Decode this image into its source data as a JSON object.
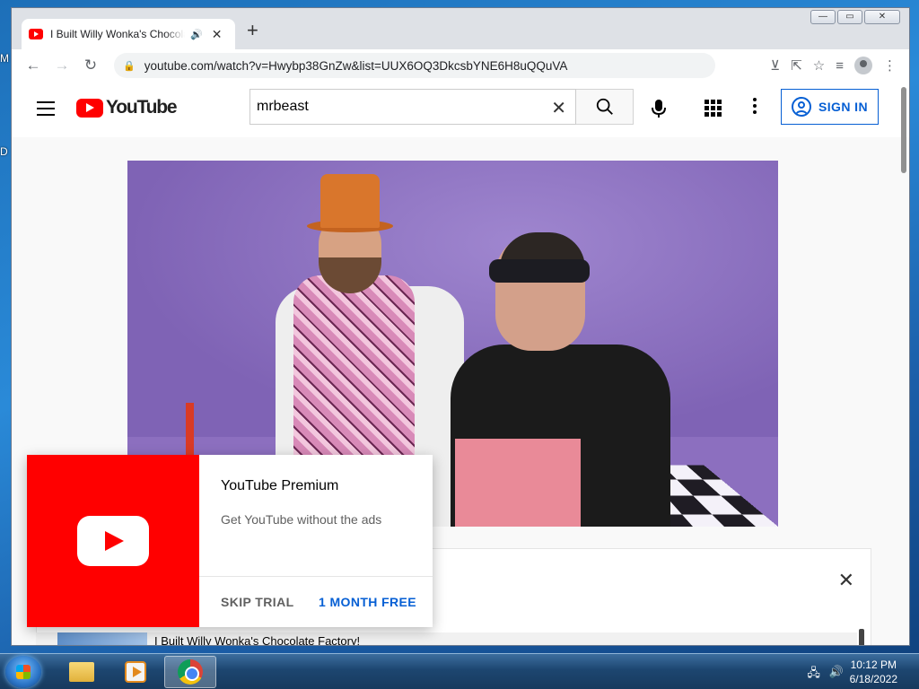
{
  "desktop": {
    "edge_labels": [
      "M",
      "D"
    ]
  },
  "browser": {
    "tab_title": "I Built Willy Wonka's Chocolate Factory!",
    "url": "youtube.com/watch?v=Hwybp38GnZw&list=UUX6OQ3DkcsbYNE6H8uQQuVA",
    "window_controls": {
      "minimize": "—",
      "maximize": "▭",
      "close": "✕"
    }
  },
  "youtube": {
    "logo_text": "YouTube",
    "search": {
      "value": "mrbeast"
    },
    "sign_in_label": "SIGN IN"
  },
  "promo": {
    "title": "YouTube Premium",
    "subtitle": "Get YouTube without the ads",
    "skip_label": "SKIP TRIAL",
    "free_label": "1 MONTH FREE"
  },
  "below_video": {
    "mini_title": "I Built Willy Wonka's Chocolate Factory!"
  },
  "taskbar": {
    "time": "10:12 PM",
    "date": "6/18/2022"
  },
  "colors": {
    "youtube_red": "#ff0000",
    "link_blue": "#065fd4"
  }
}
